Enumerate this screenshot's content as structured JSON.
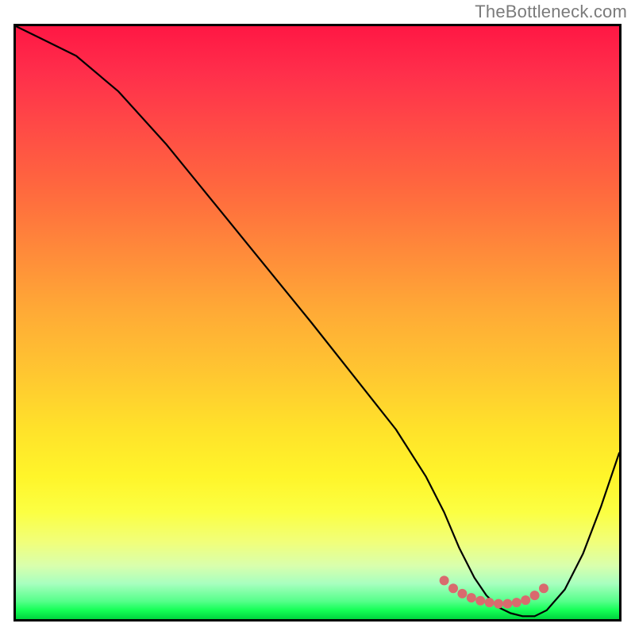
{
  "watermark": "TheBottleneck.com",
  "chart_data": {
    "type": "line",
    "title": "",
    "xlabel": "",
    "ylabel": "",
    "xlim": [
      0,
      100
    ],
    "ylim": [
      0,
      100
    ],
    "series": [
      {
        "name": "curve",
        "x": [
          0,
          4,
          10,
          17,
          25,
          33,
          41,
          49,
          56,
          63,
          68,
          71,
          73.5,
          76,
          78,
          80,
          82,
          84,
          86,
          88,
          91,
          94,
          97,
          100
        ],
        "values": [
          100,
          98,
          95,
          89,
          80,
          70,
          60,
          50,
          41,
          32,
          24,
          18,
          12,
          7,
          4,
          2,
          1,
          0.5,
          0.5,
          1.5,
          5,
          11,
          19,
          28
        ]
      },
      {
        "name": "highlight-dots",
        "x": [
          71,
          72.5,
          74,
          75.5,
          77,
          78.5,
          80,
          81.5,
          83,
          84.5,
          86,
          87.5
        ],
        "values": [
          6.5,
          5.2,
          4.3,
          3.6,
          3.1,
          2.8,
          2.6,
          2.6,
          2.8,
          3.2,
          4.0,
          5.2
        ]
      }
    ],
    "colors": {
      "curve": "#000000",
      "dots": "#d96a6e"
    }
  }
}
